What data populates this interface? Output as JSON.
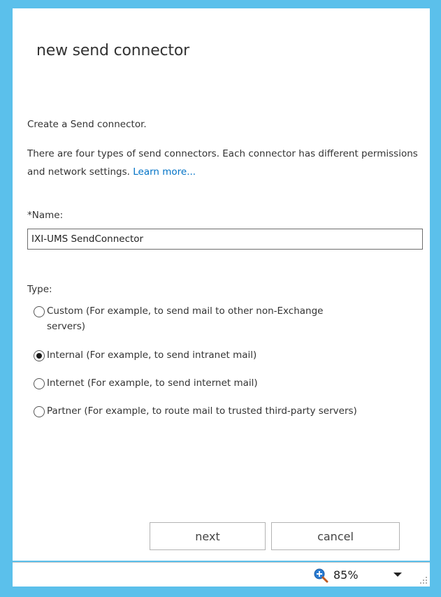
{
  "dialog": {
    "title": "new send connector",
    "intro": "Create a Send connector.",
    "description": "There are four types of send connectors. Each connector has different permissions and network settings.",
    "learn_more": "Learn more..."
  },
  "name_field": {
    "label": "*Name:",
    "value": "IXI-UMS SendConnector"
  },
  "type": {
    "label": "Type:",
    "options": [
      {
        "label": "Custom (For example, to send mail to other non-Exchange servers)",
        "checked": false
      },
      {
        "label": "Internal (For example, to send intranet mail)",
        "checked": true
      },
      {
        "label": "Internet (For example, to send internet mail)",
        "checked": false
      },
      {
        "label": "Partner (For example, to route mail to trusted third-party servers)",
        "checked": false
      }
    ]
  },
  "buttons": {
    "next": "next",
    "cancel": "cancel"
  },
  "statusbar": {
    "zoom": "85%",
    "zoom_icon": "zoom-in-icon"
  },
  "colors": {
    "frame": "#5bc0eb",
    "link": "#0072c6"
  }
}
